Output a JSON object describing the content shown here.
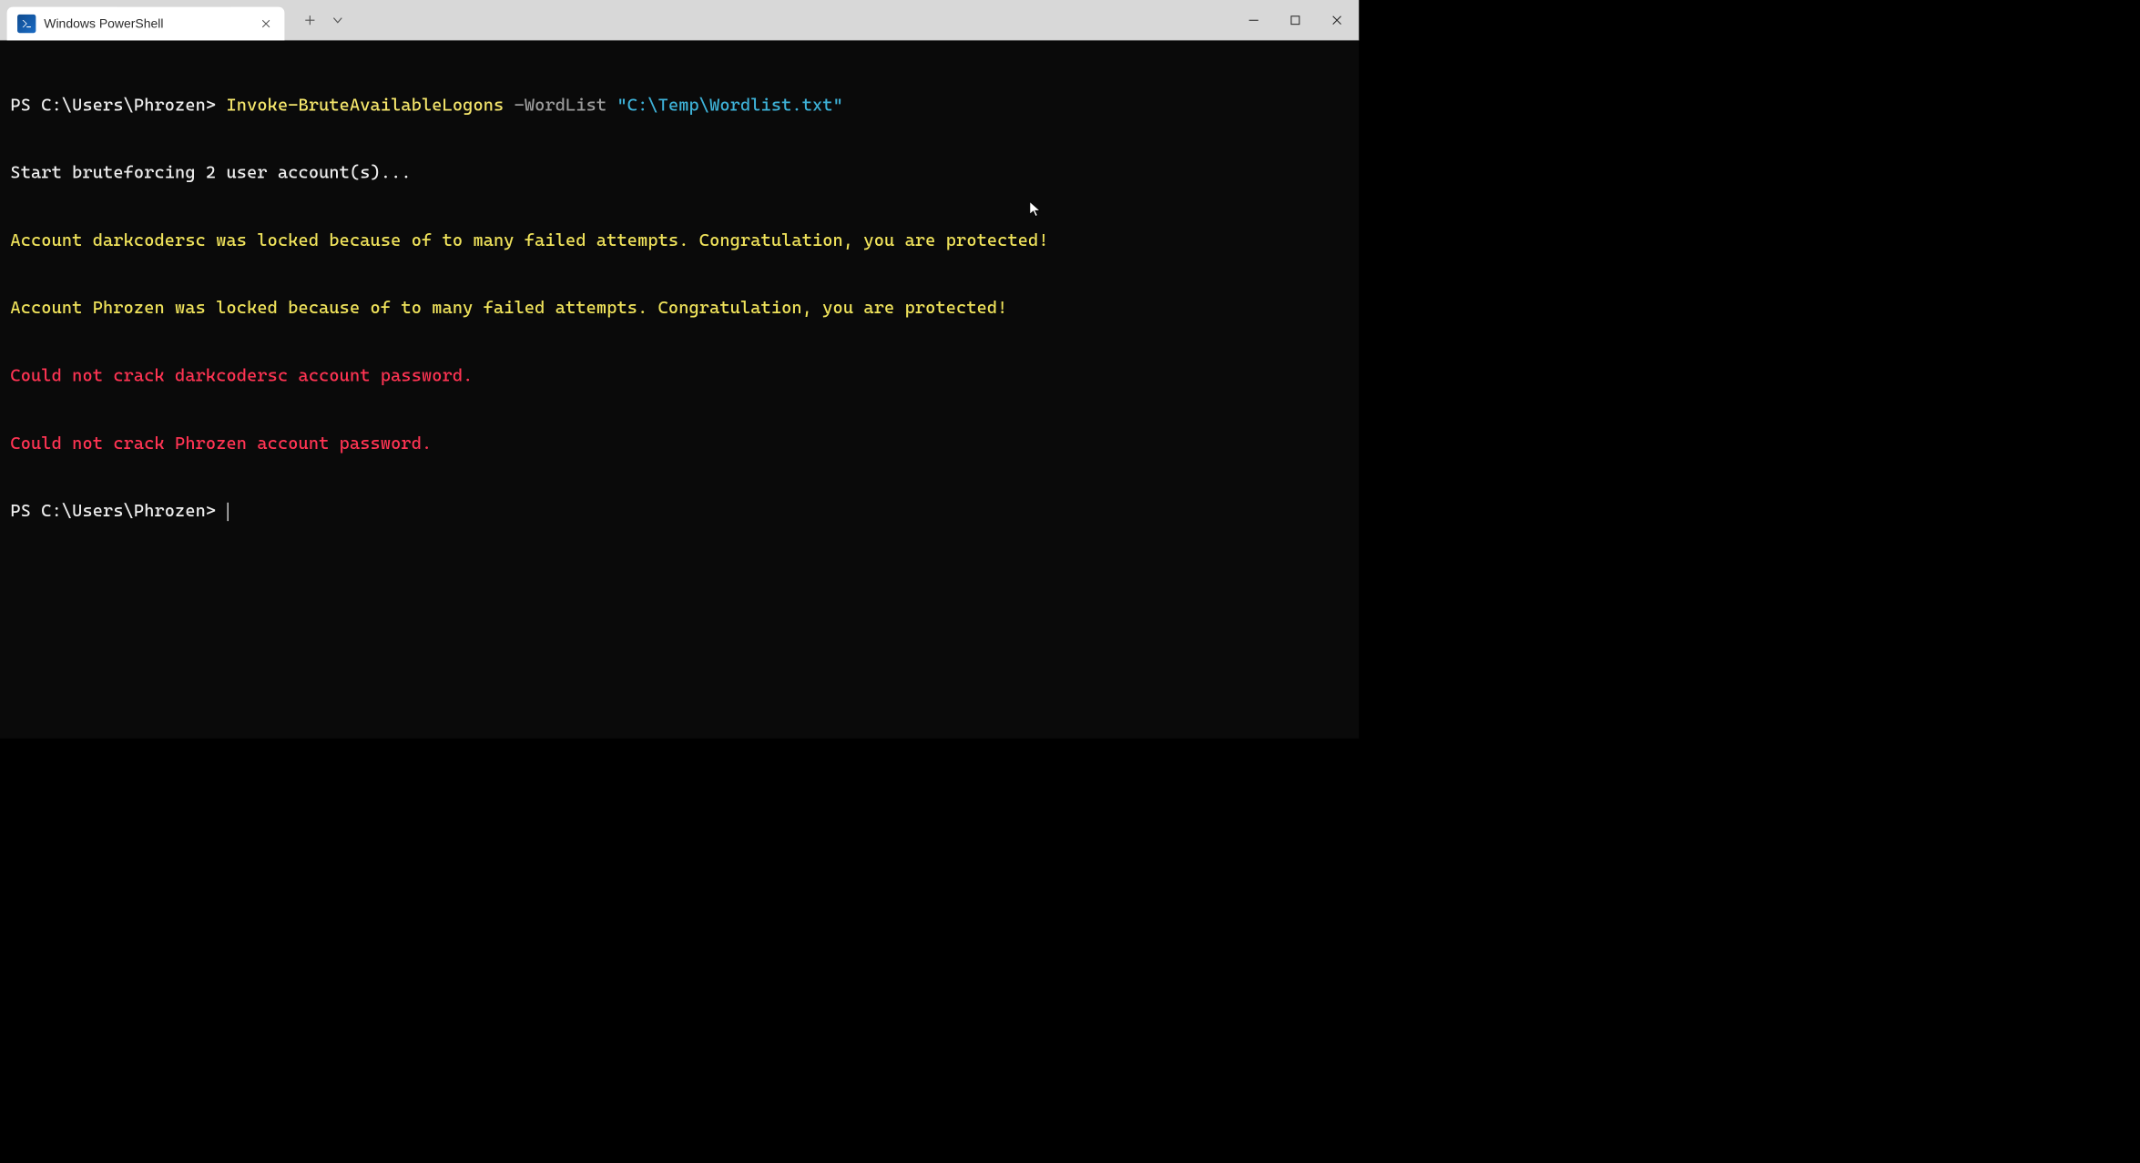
{
  "titlebar": {
    "tab": {
      "title": "Windows PowerShell"
    }
  },
  "terminal": {
    "lines": [
      {
        "prompt": "PS C:\\Users\\Phrozen> ",
        "cmd": "Invoke-BruteAvailableLogons ",
        "param": "-WordList ",
        "str": "\"C:\\Temp\\Wordlist.txt\""
      },
      {
        "info": "Start bruteforcing 2 user account(s)..."
      },
      {
        "warn": "Account darkcodersc was locked because of to many failed attempts. Congratulation, you are protected!"
      },
      {
        "warn": "Account Phrozen was locked because of to many failed attempts. Congratulation, you are protected!"
      },
      {
        "err": "Could not crack darkcodersc account password."
      },
      {
        "err": "Could not crack Phrozen account password."
      },
      {
        "prompt": "PS C:\\Users\\Phrozen> "
      }
    ]
  }
}
